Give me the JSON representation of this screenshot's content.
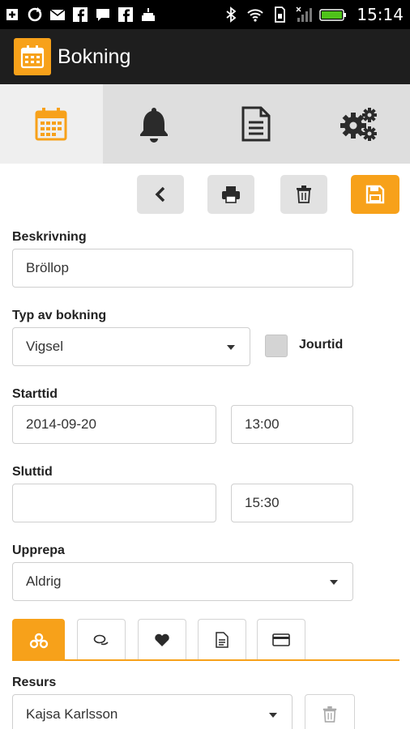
{
  "status_bar": {
    "time": "15:14",
    "icons": [
      "plus-icon",
      "sync-icon",
      "mail-icon",
      "facebook-icon",
      "chat-icon",
      "facebook-icon",
      "cake-icon",
      "bluetooth-icon",
      "wifi-icon",
      "sim-icon",
      "signal-icon",
      "battery-icon"
    ]
  },
  "action_bar": {
    "title": "Bokning",
    "icon": "calendar-icon"
  },
  "top_tabs": [
    {
      "icon": "calendar-icon",
      "active": true
    },
    {
      "icon": "bell-icon",
      "active": false
    },
    {
      "icon": "document-icon",
      "active": false
    },
    {
      "icon": "gears-icon",
      "active": false
    }
  ],
  "toolbar": {
    "buttons": [
      "back-icon",
      "print-icon",
      "trash-icon",
      "save-icon"
    ]
  },
  "form": {
    "description": {
      "label": "Beskrivning",
      "value": "Bröllop"
    },
    "booking_type": {
      "label": "Typ av bokning",
      "value": "Vigsel"
    },
    "on_call": {
      "label": "Jourtid",
      "checked": false
    },
    "start": {
      "label": "Starttid",
      "date": "2014-09-20",
      "time": "13:00"
    },
    "end": {
      "label": "Sluttid",
      "date": "",
      "time": "15:30"
    },
    "repeat": {
      "label": "Upprepa",
      "value": "Aldrig"
    }
  },
  "sub_tabs": [
    "resources-icon",
    "comments-icon",
    "heart-icon",
    "document-icon",
    "card-icon"
  ],
  "resource": {
    "label": "Resurs",
    "value": "Kajsa Karlsson"
  },
  "colors": {
    "accent": "#f7a11a",
    "actionbar": "#1e1e1e",
    "tabbar": "#dedede"
  }
}
